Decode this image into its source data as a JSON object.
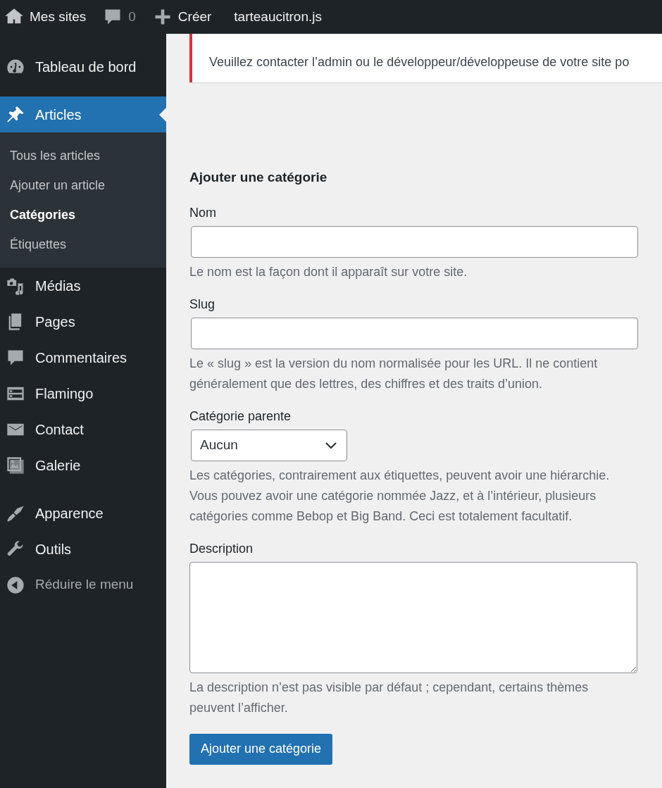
{
  "admin_bar": {
    "items": [
      {
        "kind": "sites",
        "label": "Mes sites"
      },
      {
        "kind": "comments",
        "label": "0"
      },
      {
        "kind": "new",
        "label": "Créer"
      },
      {
        "kind": "site",
        "label": "tarteaucitron.js"
      }
    ]
  },
  "sidebar": {
    "groups": [
      [
        {
          "kind": "dashboard",
          "label": "Tableau de bord",
          "selected": false
        }
      ],
      [
        {
          "kind": "pin",
          "label": "Articles",
          "selected": true,
          "children": [
            {
              "label": "Tous les articles",
              "selected": false
            },
            {
              "label": "Ajouter un article",
              "selected": false
            },
            {
              "label": "Catégories",
              "selected": true
            },
            {
              "label": "Étiquettes",
              "selected": false
            }
          ]
        },
        {
          "kind": "media",
          "label": "Médias",
          "selected": false
        },
        {
          "kind": "pages",
          "label": "Pages",
          "selected": false
        },
        {
          "kind": "comments",
          "label": "Commentaires",
          "selected": false
        },
        {
          "kind": "flamingo",
          "label": "Flamingo",
          "selected": false
        },
        {
          "kind": "mail",
          "label": "Contact",
          "selected": false
        },
        {
          "kind": "gallery",
          "label": "Galerie",
          "selected": false
        }
      ],
      [
        {
          "kind": "brush",
          "label": "Apparence",
          "selected": false
        },
        {
          "kind": "wrench",
          "label": "Outils",
          "selected": false
        }
      ]
    ],
    "collapse": {
      "label": "Réduire le menu"
    }
  },
  "notice": {
    "text": "Veuillez contacter l’admin ou le développeur/développeuse de votre site po"
  },
  "form": {
    "title": "Ajouter une catégorie",
    "fields": [
      {
        "kind": "text",
        "label": "Nom",
        "help": "Le nom est la façon dont il apparaît sur votre site."
      },
      {
        "kind": "text",
        "label": "Slug",
        "help": "Le « slug » est la version du nom normalisée pour les URL. Il ne contient généralement que des lettres, des chiffres et des traits d’union."
      },
      {
        "kind": "select",
        "label": "Catégorie parente",
        "value": "Aucun",
        "help": "Les catégories, contrairement aux étiquettes, peuvent avoir une hiérarchie. Vous pouvez avoir une catégorie nommée Jazz, et à l’intérieur, plusieurs catégories comme Bebop et Big Band. Ceci est totalement facultatif."
      },
      {
        "kind": "textarea",
        "label": "Description",
        "help": "La description n’est pas visible par défaut ; cependant, certains thèmes peuvent l’afficher."
      }
    ],
    "submit": "Ajouter une catégorie"
  }
}
